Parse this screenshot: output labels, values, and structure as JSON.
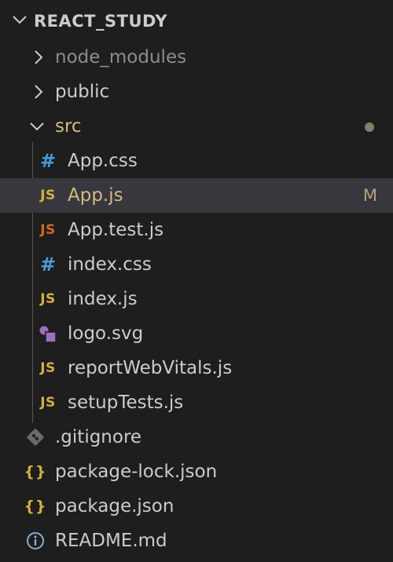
{
  "explorer": {
    "title": "REACT_STUDY",
    "items": [
      {
        "label": "node_modules",
        "kind": "folder",
        "icon": "chevron-right-icon"
      },
      {
        "label": "public",
        "kind": "folder",
        "icon": "chevron-right-icon"
      },
      {
        "label": "src",
        "kind": "folder-open",
        "icon": "chevron-down-icon"
      },
      {
        "label": "App.css",
        "kind": "css",
        "icon_text": "#"
      },
      {
        "label": "App.js",
        "kind": "js",
        "icon_text": "JS",
        "badge": "M"
      },
      {
        "label": "App.test.js",
        "kind": "js-test",
        "icon_text": "JS"
      },
      {
        "label": "index.css",
        "kind": "css",
        "icon_text": "#"
      },
      {
        "label": "index.js",
        "kind": "js",
        "icon_text": "JS"
      },
      {
        "label": "logo.svg",
        "kind": "svg"
      },
      {
        "label": "reportWebVitals.js",
        "kind": "js",
        "icon_text": "JS"
      },
      {
        "label": "setupTests.js",
        "kind": "js",
        "icon_text": "JS"
      },
      {
        "label": ".gitignore",
        "kind": "git"
      },
      {
        "label": "package-lock.json",
        "kind": "json",
        "icon_text": "{}"
      },
      {
        "label": "package.json",
        "kind": "json",
        "icon_text": "{}"
      },
      {
        "label": "README.md",
        "kind": "info"
      }
    ]
  },
  "colors": {
    "background": "#1e1e1e",
    "selected_row": "#37373d",
    "text": "#cccccc",
    "dim_text": "#8c8c8c",
    "modified_text": "#d7ba7d",
    "js_icon": "#d2b13b",
    "js_test_icon": "#d4691f",
    "css_icon": "#4a9bd6",
    "svg_icon": "#9b6fc4"
  }
}
